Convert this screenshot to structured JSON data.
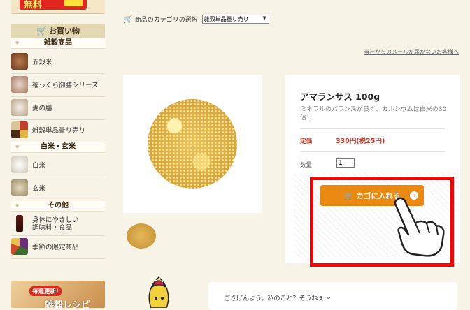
{
  "logo": {
    "text": "無料"
  },
  "sidebar": {
    "heading": "お買い物",
    "categories": [
      {
        "title": "雑穀商品"
      },
      {
        "title": "白米・玄米"
      },
      {
        "title": "その他"
      }
    ],
    "items": [
      {
        "label": "五穀米"
      },
      {
        "label": "福っくら御膳シリーズ"
      },
      {
        "label": "麦の膳"
      },
      {
        "label": "雑穀単品量り売り"
      },
      {
        "label": "白米"
      },
      {
        "label": "玄米"
      },
      {
        "label": "身体にやさしい\n調味料・食品"
      },
      {
        "label": "季節の限定商品"
      }
    ],
    "promo": {
      "badge": "毎週更新!",
      "text": "雑穀レシピ"
    }
  },
  "category_selector": {
    "label": "商品のカテゴリの選択",
    "selected": "雑穀単品量り売り"
  },
  "mail_link": "当社からのメールが届かないお客様へ",
  "product": {
    "name": "アマランサス 100g",
    "description": "ミネラルのバランスが良く、カルシウムは白米の30倍！",
    "price_label": "定価",
    "price": "330円(税25円)",
    "qty_label": "数量",
    "qty_value": "1",
    "cart_button": "カゴに入れる"
  },
  "chat": {
    "text": "ごきげんよう。私のこと？そうねぇ〜"
  },
  "colors": {
    "accent": "#ea8a12",
    "highlight": "#ff0000",
    "price": "#c0392b",
    "background": "#f7f3e6"
  }
}
